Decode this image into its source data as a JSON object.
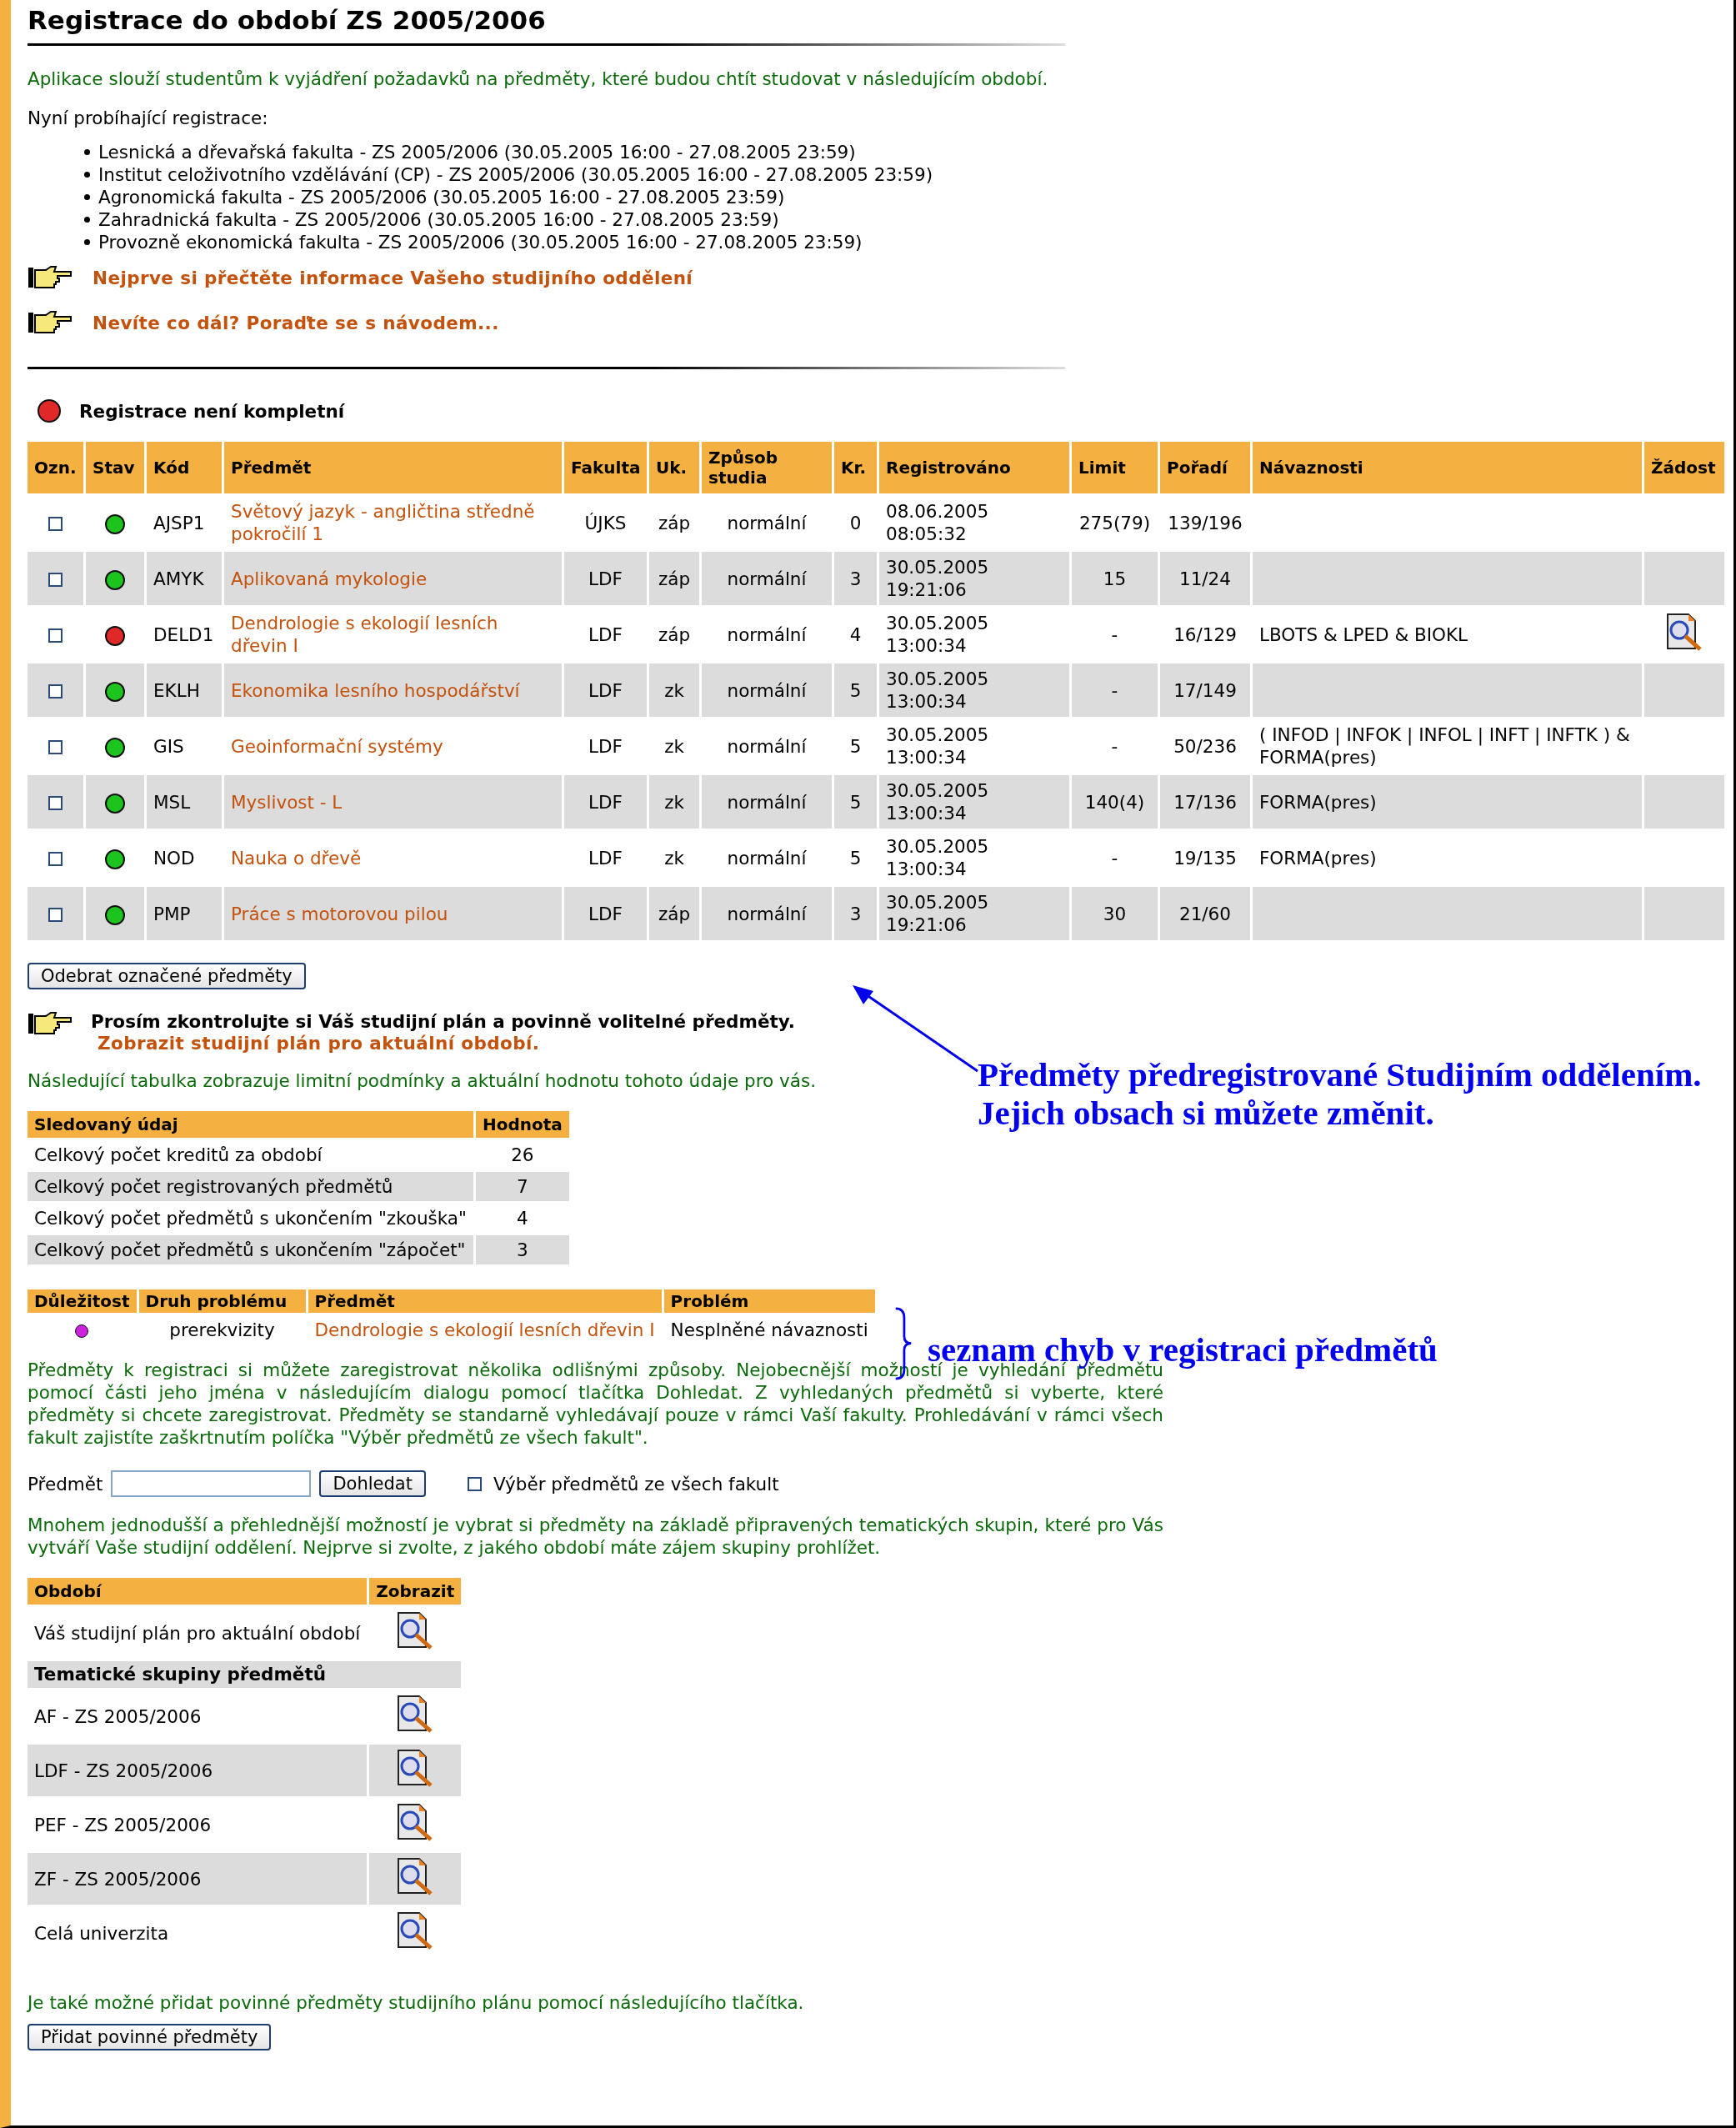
{
  "title": "Registrace do období ZS 2005/2006",
  "intro": "Aplikace slouží studentům k vyjádření požadavků na předměty, které budou chtít studovat v následujícím období.",
  "registrations_label": "Nyní probíhající registrace:",
  "registrations": [
    "Lesnická a dřevařská fakulta - ZS 2005/2006 (30.05.2005 16:00 - 27.08.2005 23:59)",
    "Institut celoživotního vzdělávání (CP) - ZS 2005/2006 (30.05.2005 16:00 - 27.08.2005 23:59)",
    "Agronomická fakulta - ZS 2005/2006 (30.05.2005 16:00 - 27.08.2005 23:59)",
    "Zahradnická fakulta - ZS 2005/2006 (30.05.2005 16:00 - 27.08.2005 23:59)",
    "Provozně ekonomická fakulta - ZS 2005/2006 (30.05.2005 16:00 - 27.08.2005 23:59)"
  ],
  "info_links": [
    "Nejprve si přečtěte informace Vašeho studijního oddělení",
    "Nevíte co dál? Poraďte se s návodem..."
  ],
  "status": {
    "text": "Registrace není kompletní",
    "color": "#e02828"
  },
  "courses_table": {
    "columns": [
      "Ozn.",
      "Stav",
      "Kód",
      "Předmět",
      "Fakulta",
      "Uk.",
      "Způsob studia",
      "Kr.",
      "Registrováno",
      "Limit",
      "Pořadí",
      "Návaznosti",
      "Žádost"
    ],
    "rows": [
      {
        "checked": false,
        "color": "#1ec41e",
        "code": "AJSP1",
        "name": "Světový jazyk - angličtina středně pokročilí 1",
        "faculty": "ÚJKS",
        "completion": "záp",
        "mode": "normální",
        "credits": "0",
        "registered_date": "08.06.2005",
        "registered_time": "08:05:32",
        "limit": "275(79)",
        "order": "139/196",
        "request": false
      },
      {
        "checked": false,
        "color": "#1ec41e",
        "code": "AMYK",
        "name": "Aplikovaná mykologie",
        "faculty": "LDF",
        "completion": "záp",
        "mode": "normální",
        "credits": "3",
        "registered_date": "30.05.2005",
        "registered_time": "19:21:06",
        "limit": "15",
        "order": "11/24",
        "request": false
      },
      {
        "checked": false,
        "color": "#e02828",
        "code": "DELD1",
        "name": "Dendrologie s ekologií lesních dřevin I",
        "faculty": "LDF",
        "completion": "záp",
        "mode": "normální",
        "credits": "4",
        "registered_date": "30.05.2005",
        "registered_time": "13:00:34",
        "limit": "-",
        "order": "16/129",
        "prerequisites": "LBOTS & LPED & BIOKL",
        "request": true
      },
      {
        "checked": false,
        "color": "#1ec41e",
        "code": "EKLH",
        "name": "Ekonomika lesního hospodářství",
        "faculty": "LDF",
        "completion": "zk",
        "mode": "normální",
        "credits": "5",
        "registered_date": "30.05.2005",
        "registered_time": "13:00:34",
        "limit": "-",
        "order": "17/149",
        "request": false
      },
      {
        "checked": false,
        "color": "#1ec41e",
        "code": "GIS",
        "name": "Geoinformační systémy",
        "faculty": "LDF",
        "completion": "zk",
        "mode": "normální",
        "credits": "5",
        "registered_date": "30.05.2005",
        "registered_time": "13:00:34",
        "limit": "-",
        "order": "50/236",
        "prerequisites": "( INFOD | INFOK | INFOL | INFT | INFTK ) & FORMA(pres)",
        "request": false
      },
      {
        "checked": false,
        "color": "#1ec41e",
        "code": "MSL",
        "name": "Myslivost - L",
        "faculty": "LDF",
        "completion": "zk",
        "mode": "normální",
        "credits": "5",
        "registered_date": "30.05.2005",
        "registered_time": "13:00:34",
        "limit": "140(4)",
        "order": "17/136",
        "prerequisites": "FORMA(pres)",
        "request": false
      },
      {
        "checked": false,
        "color": "#1ec41e",
        "code": "NOD",
        "name": "Nauka o dřevě",
        "faculty": "LDF",
        "completion": "zk",
        "mode": "normální",
        "credits": "5",
        "registered_date": "30.05.2005",
        "registered_time": "13:00:34",
        "limit": "-",
        "order": "19/135",
        "prerequisites": "FORMA(pres)",
        "request": false
      },
      {
        "checked": false,
        "color": "#1ec41e",
        "code": "PMP",
        "name": "Práce s motorovou pilou",
        "faculty": "LDF",
        "completion": "záp",
        "mode": "normální",
        "credits": "3",
        "registered_date": "30.05.2005",
        "registered_time": "19:21:06",
        "limit": "30",
        "order": "21/60",
        "request": false
      }
    ]
  },
  "remove_button": "Odebrat označené předměty",
  "check_notice": {
    "text": "Prosím zkontrolujte si Váš studijní plán a povinně volitelné předměty.",
    "link": "Zobrazit studijní plán pro aktuální období."
  },
  "limits_intro": "Následující tabulka zobrazuje limitní podmínky a aktuální hodnotu tohoto údaje pro vás.",
  "limits_table": {
    "columns": [
      "Sledovaný údaj",
      "Hodnota"
    ],
    "rows": [
      {
        "label": "Celkový počet kreditů za období",
        "value": "26"
      },
      {
        "label": "Celkový počet registrovaných předmětů",
        "value": "7"
      },
      {
        "label": "Celkový počet předmětů s ukončením \"zkouška\"",
        "value": "4"
      },
      {
        "label": "Celkový počet předmětů s ukončením \"zápočet\"",
        "value": "3"
      }
    ]
  },
  "problems_table": {
    "columns": [
      "Důležitost",
      "Druh problému",
      "Předmět",
      "Problém"
    ],
    "rows": [
      {
        "color": "#cc22dd",
        "type": "prerekvizity",
        "course": "Dendrologie s ekologií lesních dřevin I",
        "problem": "Nesplněné návaznosti"
      }
    ]
  },
  "search_intro": "Předměty k registraci si můžete zaregistrovat několika odlišnými způsoby. Nejobecnější možností je vyhledání předmětu pomocí části jeho jména v následujícím dialogu pomocí tlačítka Dohledat. Z vyhledaných předmětů si vyberte, které předměty si chcete zaregistrovat. Předměty se standarně vyhledávají pouze v rámci Vaší fakulty. Prohledávání v rámci všech fakult zajistíte zaškrtnutím políčka \"Výběr předmětů ze všech fakult\".",
  "search": {
    "label": "Předmět",
    "button": "Dohledat",
    "all_faculties": {
      "label": "Výběr předmětů ze všech fakult",
      "checked": false
    }
  },
  "groups_intro": "Mnohem jednodušší a přehlednější možností je vybrat si předměty na základě připravených tematických skupin, které pro Vás vytváří Vaše studijní oddělení. Nejprve si zvolte, z jakého období máte zájem skupiny prohlížet.",
  "periods_table": {
    "columns": [
      "Období",
      "Zobrazit"
    ],
    "rows": [
      {
        "kind": "item",
        "label": "Váš studijní plán pro aktuální období"
      },
      {
        "kind": "group",
        "label": "Tematické skupiny předmětů"
      },
      {
        "kind": "item",
        "label": "AF - ZS 2005/2006"
      },
      {
        "kind": "item",
        "label": "LDF - ZS 2005/2006"
      },
      {
        "kind": "item",
        "label": "PEF - ZS 2005/2006"
      },
      {
        "kind": "item",
        "label": "ZF - ZS 2005/2006"
      },
      {
        "kind": "item",
        "label": "Celá univerzita"
      }
    ]
  },
  "add_intro": "Je také možné přidat povinné předměty studijního plánu pomocí následujícího tlačítka.",
  "add_button": "Přidat povinné předměty",
  "annotations": [
    {
      "kind": "arrow",
      "lines": [
        "Předměty předregistrované Studijním oddělením.",
        "Jejich obsach si můžete změnit."
      ]
    },
    {
      "kind": "brace",
      "lines": [
        "seznam chyb v registraci předmětů"
      ]
    }
  ]
}
